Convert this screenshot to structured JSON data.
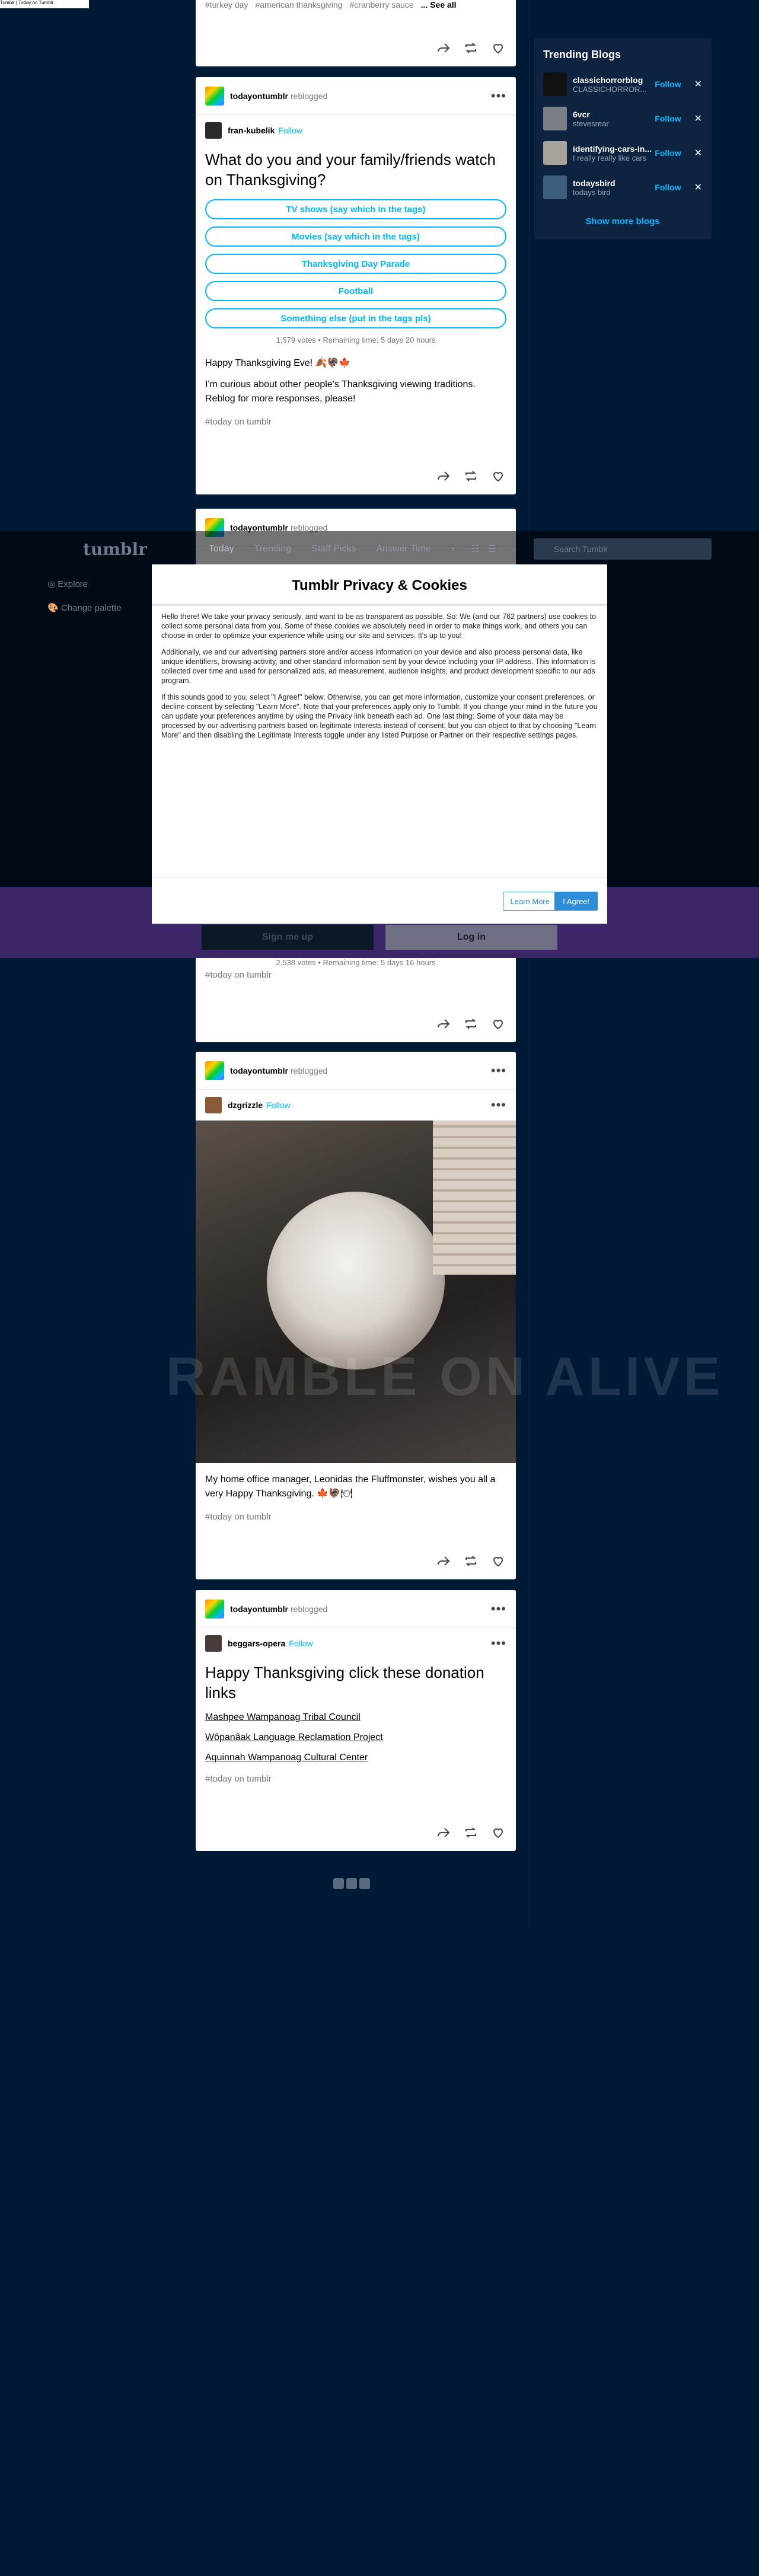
{
  "top_strip": "Tumblr | Today on Tumblr",
  "post1": {
    "tags": [
      "#turkey day",
      "#american thanksgiving",
      "#cranberry sauce"
    ],
    "see_all": "... See all"
  },
  "post2": {
    "reblogger": "todayontumblr",
    "reblogged": "reblogged",
    "author": "fran-kubelik",
    "follow": "Follow",
    "title": "What do you and your family/friends watch on Thanksgiving?",
    "options": [
      "TV shows (say which in the tags)",
      "Movies (say which in the tags)",
      "Thanksgiving Day Parade",
      "Football",
      "Something else (put in the tags pls)"
    ],
    "votes": "1,579 votes • Remaining time: 5 days 20 hours",
    "text1": "Happy Thanksgiving Eve! 🍂🦃🍁",
    "text2": "I'm curious about other people's Thanksgiving viewing traditions. Reblog for more responses, please!",
    "tag": "#today on tumblr"
  },
  "post3": {
    "reblogger": "todayontumblr",
    "reblogged": "reblogged",
    "votes": "2,538 votes • Remaining time: 5 days 16 hours",
    "tag": "#today on tumblr"
  },
  "post4": {
    "reblogger": "todayontumblr",
    "reblogged": "reblogged",
    "author": "dzgrizzle",
    "follow": "Follow",
    "text": "My home office manager, Leonidas the Fluffmonster, wishes you all a very Happy Thanksgiving. 🍁🦃🍽",
    "tag": "#today on tumblr"
  },
  "post5": {
    "reblogger": "todayontumblr",
    "reblogged": "reblogged",
    "author": "beggars-opera",
    "follow": "Follow",
    "title": "Happy Thanksgiving click these donation links",
    "links": [
      "Mashpee Wampanoag Tribal Council",
      "Wôpanâak Language Reclamation Project",
      "Aquinnah Wampanoag Cultural Center"
    ],
    "tag": "#today on tumblr"
  },
  "sidebar": {
    "title": "Trending Blogs",
    "blogs": [
      {
        "name": "classichorrorblog",
        "sub": "CLASSICHORROR...",
        "follow": "Follow"
      },
      {
        "name": "6vcr",
        "sub": "stevesrear",
        "follow": "Follow"
      },
      {
        "name": "identifying-cars-in...",
        "sub": "I really really like cars",
        "follow": "Follow"
      },
      {
        "name": "todaysbird",
        "sub": "todays bird",
        "follow": "Follow"
      }
    ],
    "more": "Show more blogs"
  },
  "nav": {
    "logo": "tumblr",
    "tabs": [
      "Today",
      "Trending",
      "Staff Picks",
      "Answer Time"
    ],
    "search_placeholder": "Search Tumblr",
    "left_items": [
      "Explore",
      "Change palette"
    ]
  },
  "auth": {
    "signup": "Sign me up",
    "login": "Log in"
  },
  "modal": {
    "title": "Tumblr Privacy & Cookies",
    "p1": "Hello there! We take your privacy seriously, and want to be as transparent as possible. So: We (and our 762 partners) use cookies to collect some personal data from you. Some of these cookies we absolutely need in order to make things work, and others you can choose in order to optimize your experience while using our site and services. It's up to you!",
    "p2": "Additionally, we and our advertising partners store and/or access information on your device and also process personal data, like unique identifiers, browsing activity, and other standard information sent by your device including your IP address. This information is collected over time and used for personalized ads, ad measurement, audience insights, and product development specific to our ads program.",
    "p3": "If this sounds good to you, select \"I Agree!\" below. Otherwise, you can get more information, customize your consent preferences, or decline consent by selecting \"Learn More\". Note that your preferences apply only to Tumblr. If you change your mind in the future you can update your preferences anytime by using the Privacy link beneath each ad. One last thing: Some of your data may be processed by our advertising partners based on legitimate interests instead of consent, but you can object to that by choosing \"Learn More\" and then disabling the Legitimate Interests toggle under any listed Purpose or Partner on their respective settings pages.",
    "learn_more": "Learn More",
    "agree": "I Agree!"
  },
  "watermark": "RAMBLE ON ALIVE"
}
